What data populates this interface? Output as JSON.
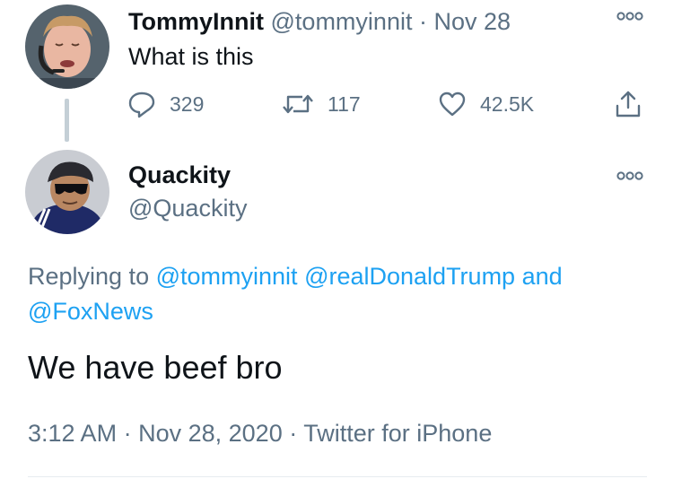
{
  "parent_tweet": {
    "display_name": "TommyInnit",
    "handle": "@tommyinnit",
    "separator": "·",
    "date": "Nov 28",
    "text": "What is this",
    "reply_count": "329",
    "retweet_count": "117",
    "like_count": "42.5K",
    "avatar_icon": "avatar-tommyinnit"
  },
  "reply_tweet": {
    "display_name": "Quackity",
    "handle": "@Quackity",
    "avatar_icon": "avatar-quackity",
    "replying_to_label": "Replying to",
    "mention_1": "@tommyinnit",
    "mention_2": "@realDonaldTrump",
    "conjunction": "and",
    "mention_3": "@FoxNews",
    "text": "We have beef bro",
    "time": "3:12 AM",
    "separator": "·",
    "date": "Nov 28, 2020",
    "source": "Twitter for iPhone"
  },
  "colors": {
    "link": "#1da1f2",
    "muted": "#5b7083",
    "text": "#0f1419",
    "thread_line": "#c4cfd6"
  },
  "icons": [
    "reply-icon",
    "retweet-icon",
    "like-icon",
    "share-icon",
    "more-icon"
  ]
}
